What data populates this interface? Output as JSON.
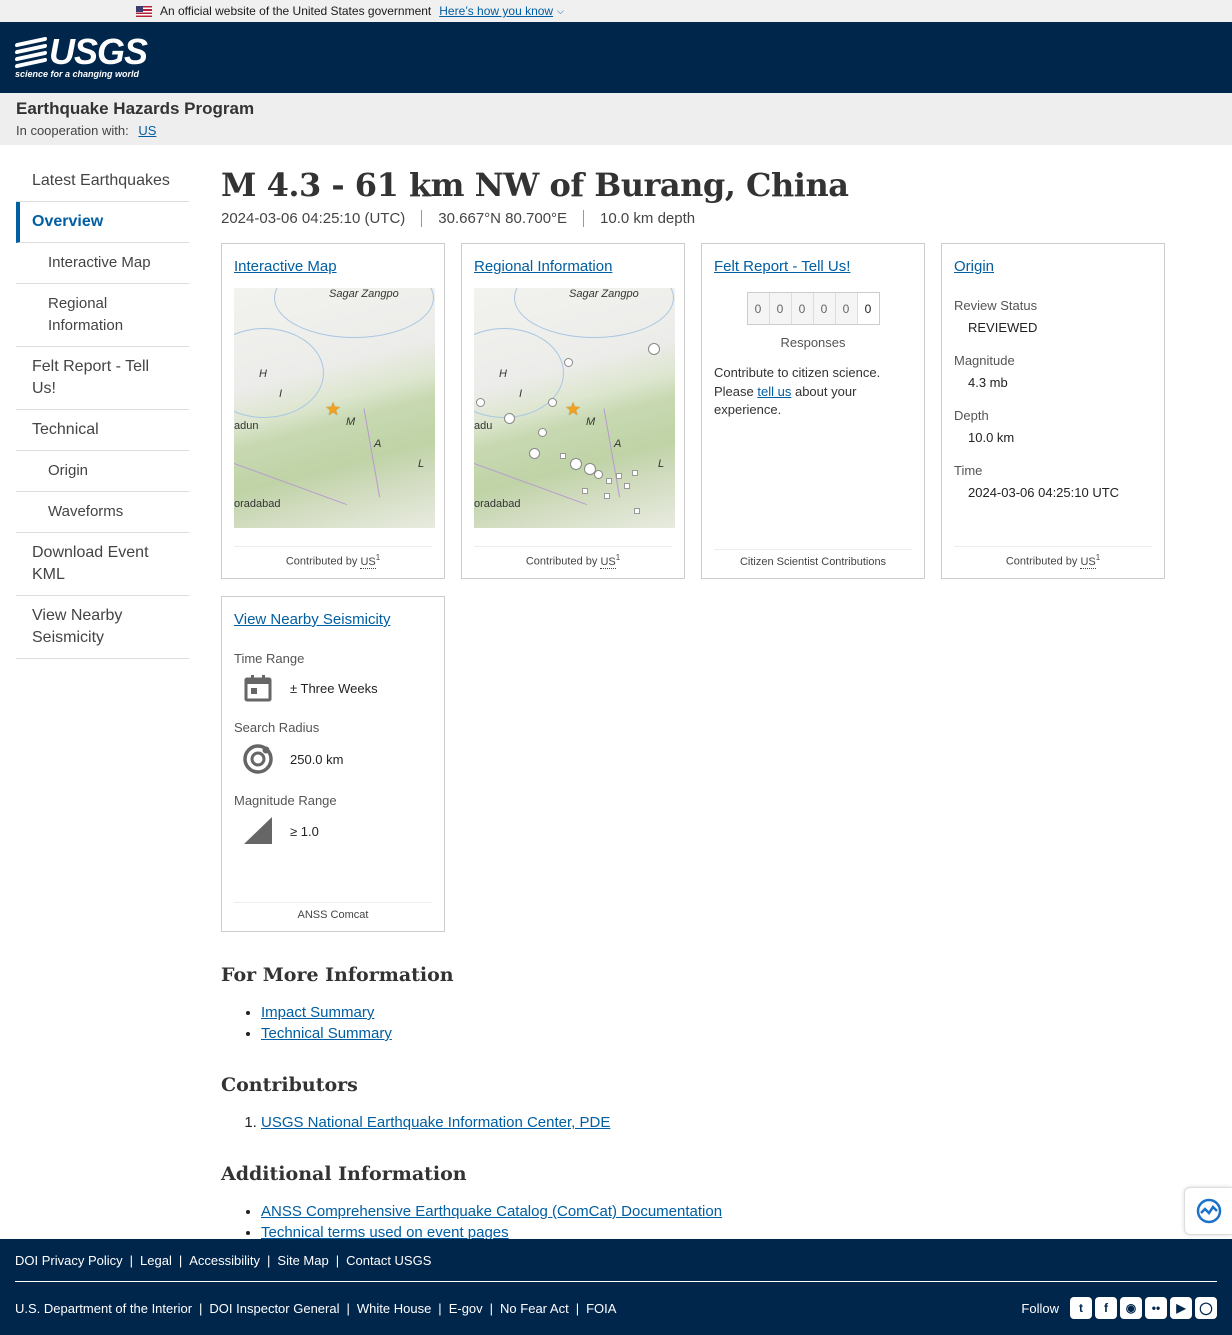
{
  "gov_banner": {
    "text": "An official website of the United States government",
    "link": "Here’s how you know"
  },
  "header": {
    "logo": "USGS",
    "tagline": "science for a changing world"
  },
  "program": {
    "title": "Earthquake Hazards Program",
    "coop_label": "In cooperation with:",
    "coop_link": "US"
  },
  "sidebar": {
    "items": [
      {
        "label": "Latest Earthquakes"
      },
      {
        "label": "Overview"
      },
      {
        "label": "Interactive Map"
      },
      {
        "label": "Regional Information"
      },
      {
        "label": "Felt Report - Tell Us!"
      },
      {
        "label": "Technical"
      },
      {
        "label": "Origin"
      },
      {
        "label": "Waveforms"
      },
      {
        "label": "Download Event KML"
      },
      {
        "label": "View Nearby Seismicity"
      }
    ]
  },
  "event": {
    "title": "M 4.3 - 61 km NW of Burang, China",
    "time": "2024-03-06 04:25:10 (UTC)",
    "coords": "30.667°N 80.700°E",
    "depth": "10.0 km depth"
  },
  "cards": {
    "interactive_map": {
      "link": "Interactive Map",
      "footer": "Contributed by",
      "source": "US",
      "sup": "1",
      "map_labels": {
        "river": "Sagar Zangpo",
        "letters": [
          "H",
          "I",
          "M",
          "A",
          "L"
        ],
        "place1": "adun",
        "place2": "oradabad"
      }
    },
    "regional": {
      "link": "Regional Information",
      "footer": "Contributed by",
      "source": "US",
      "sup": "1",
      "map_labels": {
        "river": "Sagar Zangpo",
        "letters": [
          "H",
          "I",
          "M",
          "A",
          "L"
        ],
        "place1": "adu",
        "place2": "oradabad"
      }
    },
    "felt": {
      "link": "Felt Report - Tell Us!",
      "counter": [
        "0",
        "0",
        "0",
        "0",
        "0",
        "0"
      ],
      "responses": "Responses",
      "text_before": "Contribute to citizen science. Please",
      "tell_us": "tell us",
      "text_after": "about your experience.",
      "footer": "Citizen Scientist Contributions"
    },
    "origin": {
      "link": "Origin",
      "review_label": "Review Status",
      "review_value": "REVIEWED",
      "magnitude_label": "Magnitude",
      "magnitude_value": "4.3 mb",
      "depth_label": "Depth",
      "depth_value": "10.0 km",
      "time_label": "Time",
      "time_value": "2024-03-06 04:25:10 UTC",
      "footer": "Contributed by",
      "source": "US",
      "sup": "1"
    },
    "seismicity": {
      "link": "View Nearby Seismicity",
      "time_label": "Time Range",
      "time_value": "± Three Weeks",
      "radius_label": "Search Radius",
      "radius_value": "250.0 km",
      "mag_label": "Magnitude Range",
      "mag_value": "≥ 1.0",
      "footer": "ANSS Comcat"
    }
  },
  "more_info": {
    "heading": "For More Information",
    "links": [
      "Impact Summary",
      "Technical Summary"
    ]
  },
  "contributors": {
    "heading": "Contributors",
    "links": [
      "USGS National Earthquake Information Center, PDE"
    ]
  },
  "additional": {
    "heading": "Additional Information",
    "links": [
      "ANSS Comprehensive Earthquake Catalog (ComCat) Documentation",
      "Technical terms used on event pages"
    ]
  },
  "footer": {
    "row1": [
      "DOI Privacy Policy",
      "Legal",
      "Accessibility",
      "Site Map",
      "Contact USGS"
    ],
    "row2": [
      "U.S. Department of the Interior",
      "DOI Inspector General",
      "White House",
      "E-gov",
      "No Fear Act",
      "FOIA"
    ],
    "follow": "Follow",
    "social_icons": [
      "twitter-icon",
      "facebook-icon",
      "github-icon",
      "flickr-icon",
      "youtube-icon",
      "instagram-icon"
    ]
  },
  "colors": {
    "header_bg": "#00264c",
    "link": "#005ea2",
    "star": "#f1a020"
  }
}
